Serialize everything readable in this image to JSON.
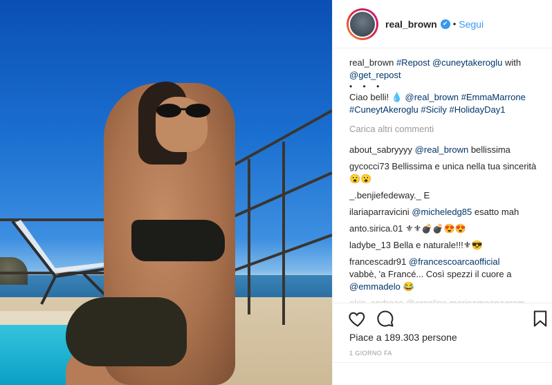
{
  "post": {
    "username": "real_brown",
    "follow_label": "Segui",
    "separator": "•",
    "verified_glyph": "✔"
  },
  "caption": {
    "username": "real_brown",
    "line1_links": "#Repost @cuneytakeroglu",
    "line1_rest": " with",
    "line2_link": "@get_repost",
    "dots": "• • •",
    "text_start": "Ciao belli! ",
    "drop_emoji": "💧",
    "tags": "@real_brown #EmmaMarrone #CuneytAkeroglu #Sicily #HolidayDay1"
  },
  "load_more_label": "Carica altri commenti",
  "comments": [
    {
      "user": "about_sabryyyy",
      "link": "@real_brown",
      "text": " bellissima"
    },
    {
      "user": "gycocci73",
      "link": "",
      "text": " Bellissima e unica nella tua sincerità 😮😮"
    },
    {
      "user": "_.benjiefedeway._",
      "link": "",
      "text": " E"
    },
    {
      "user": "ilariaparravicini",
      "link": "@micheledg85",
      "text": " esatto mah"
    },
    {
      "user": "anto.sirica.01",
      "link": "",
      "text": " ⚜⚜💣💣😍😍"
    },
    {
      "user": "ladybe_13",
      "link": "",
      "text": " Bella e naturale!!!⚜😎"
    },
    {
      "user": "francescadr91",
      "link": "@francescoarcaofficial",
      "text": " vabbè, 'a Francé... Così spezzi il cuore a ",
      "link2": "@emmadelo",
      "text2": " 😂"
    }
  ],
  "faded_comment": "okin_andreas @ergeline marinamoonagram",
  "likes": "Piace a 189.303 persone",
  "timestamp": "1 GIORNO FA",
  "icons": {
    "like": "heart-icon",
    "comment": "comment-bubble-icon",
    "save": "bookmark-icon"
  }
}
